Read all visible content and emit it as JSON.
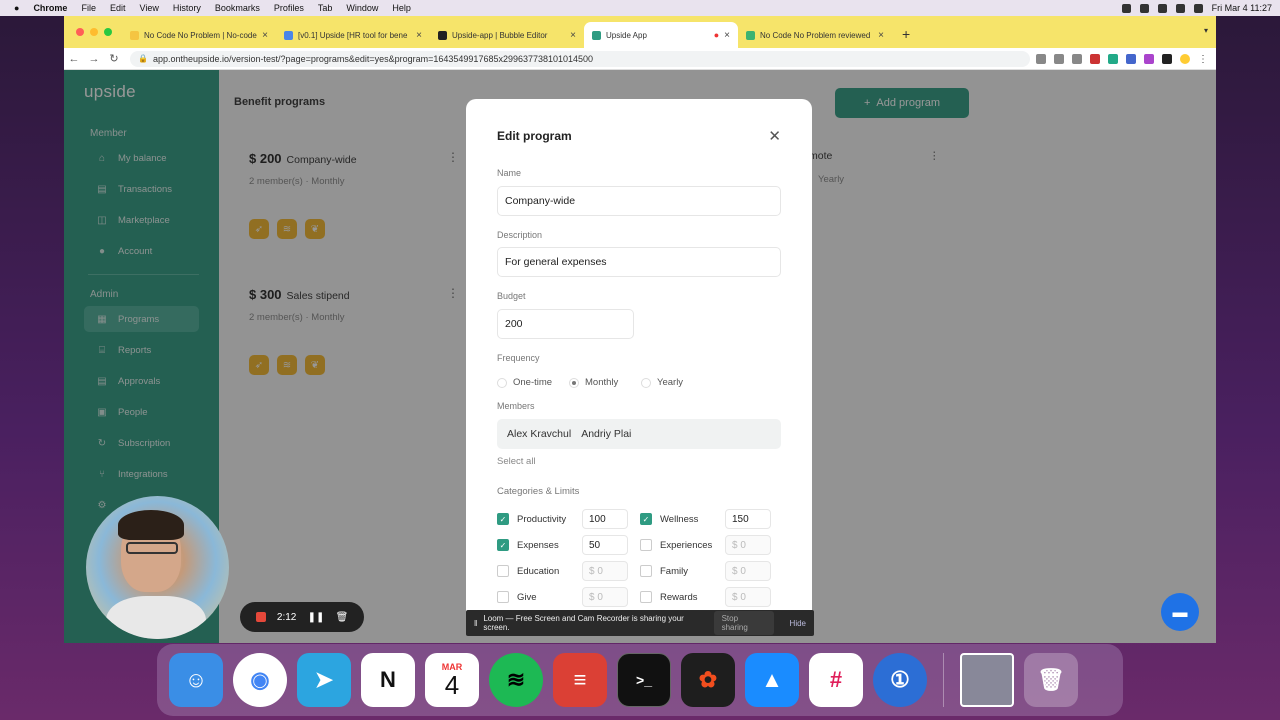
{
  "menubar": {
    "apple": "",
    "items": [
      "Chrome",
      "File",
      "Edit",
      "View",
      "History",
      "Bookmarks",
      "Profiles",
      "Tab",
      "Window",
      "Help"
    ],
    "clock": "Fri Mar 4  11:27"
  },
  "tabs": [
    {
      "title": "No Code No Problem | No-code",
      "color": "#f5c542"
    },
    {
      "title": "[v0.1] Upside [HR tool for bene",
      "color": "#4a86e8"
    },
    {
      "title": "Upside-app | Bubble Editor",
      "color": "#222"
    },
    {
      "title": "Upside App",
      "color": "#2f9b82",
      "active": true
    },
    {
      "title": "No Code No Problem reviewed",
      "color": "#3cb371"
    }
  ],
  "url": "app.ontheupside.io/version-test/?page=programs&edit=yes&program=1643549917685x299637738101014500",
  "sidebar": {
    "logo": "upside",
    "member_label": "Member",
    "member_items": [
      "My balance",
      "Transactions",
      "Marketplace",
      "Account"
    ],
    "admin_label": "Admin",
    "admin_items": [
      "Programs",
      "Reports",
      "Approvals",
      "People",
      "Subscription",
      "Integrations"
    ]
  },
  "main": {
    "title": "Benefit programs",
    "add_button": "Add program",
    "cards": [
      {
        "amount": "$ 200",
        "name": "Company-wide",
        "meta": "2 member(s)  ·  Monthly"
      },
      {
        "amount": "$ 300",
        "name": "Sales stipend",
        "meta": "2 member(s)  ·  Monthly"
      }
    ],
    "partial_card": {
      "name": "mote",
      "meta": "Yearly"
    }
  },
  "modal": {
    "title": "Edit program",
    "name_label": "Name",
    "name_value": "Company-wide",
    "desc_label": "Description",
    "desc_value": "For general expenses",
    "budget_label": "Budget",
    "budget_value": "200",
    "freq_label": "Frequency",
    "freq_options": [
      "One-time",
      "Monthly",
      "Yearly"
    ],
    "freq_selected": "Monthly",
    "members_label": "Members",
    "members": [
      "Alex Kravchul",
      "Andriy Plai"
    ],
    "select_all": "Select all",
    "categories_label": "Categories & Limits",
    "categories": [
      {
        "name": "Productivity",
        "checked": true,
        "limit": "100"
      },
      {
        "name": "Wellness",
        "checked": true,
        "limit": "150"
      },
      {
        "name": "Expenses",
        "checked": true,
        "limit": "50"
      },
      {
        "name": "Experiences",
        "checked": false,
        "limit": "$ 0"
      },
      {
        "name": "Education",
        "checked": false,
        "limit": "$ 0"
      },
      {
        "name": "Family",
        "checked": false,
        "limit": "$ 0"
      },
      {
        "name": "Give",
        "checked": false,
        "limit": "$ 0"
      },
      {
        "name": "Rewards",
        "checked": false,
        "limit": "$ 0"
      }
    ]
  },
  "loom": {
    "text": "Loom — Free Screen and Cam Recorder is sharing your screen.",
    "stop": "Stop sharing",
    "hide": "Hide"
  },
  "recorder": {
    "time": "2:12"
  },
  "dock": {
    "calendar_month": "MAR",
    "calendar_day": "4"
  }
}
